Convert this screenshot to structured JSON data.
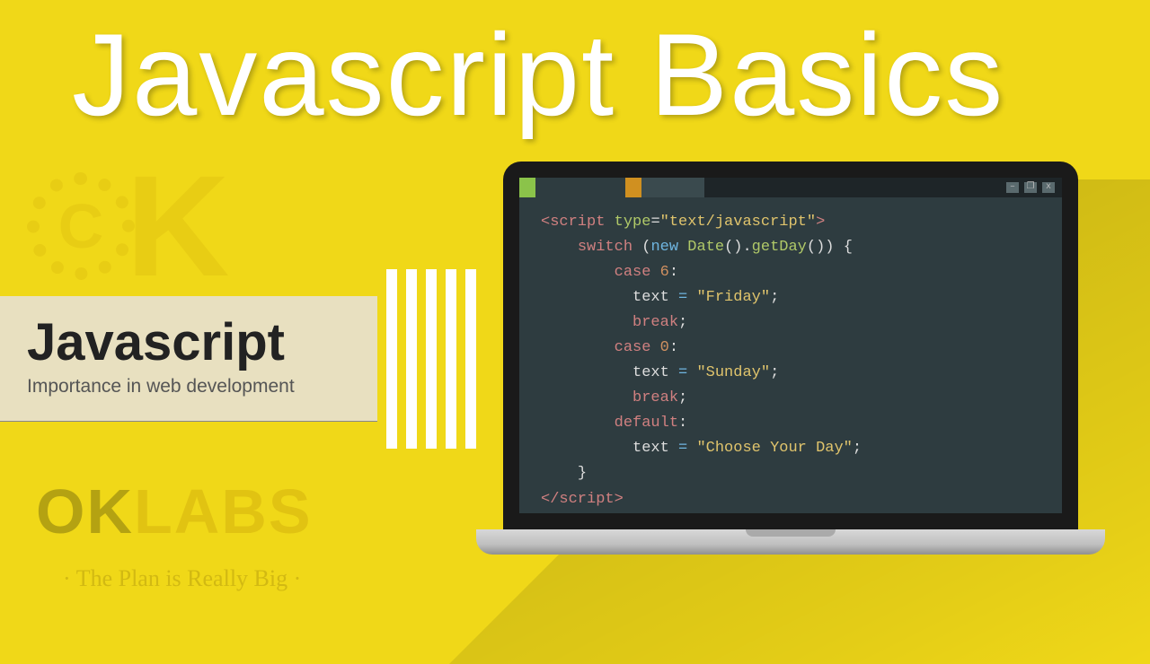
{
  "title": "Javascript Basics",
  "banner": {
    "heading": "Javascript",
    "subtext": "Importance in web development"
  },
  "watermark": {
    "brand_ok": "OK",
    "brand_labs": "LABS",
    "tagline": "· The Plan is Really Big ·"
  },
  "code": {
    "line1_open": "<script",
    "line1_attr": " type",
    "line1_eq": "=",
    "line1_val": "\"text/javascript\"",
    "line1_close": ">",
    "line2_kw": "switch",
    "line2_paren_open": " (",
    "line2_new": "new",
    "line2_date": " Date",
    "line2_call1": "().",
    "line2_getday": "getDay",
    "line2_call2": "()) {",
    "line3_case": "case",
    "line3_num": " 6",
    "line3_colon": ":",
    "line4_var": "text ",
    "line4_eq": "= ",
    "line4_str": "\"Friday\"",
    "line4_semi": ";",
    "line5": "break",
    "line5_semi": ";",
    "line6_case": "case",
    "line6_num": " 0",
    "line6_colon": ":",
    "line7_var": "text ",
    "line7_eq": "= ",
    "line7_str": "\"Sunday\"",
    "line7_semi": ";",
    "line8": "break",
    "line8_semi": ";",
    "line9": "default",
    "line9_colon": ":",
    "line10_var": "text ",
    "line10_eq": "= ",
    "line10_str": "\"Choose Your Day\"",
    "line10_semi": ";",
    "line11": "}",
    "line12": "</scr",
    "line12b": "ipt>"
  },
  "window_controls": {
    "min": "–",
    "max": "❐",
    "close": "x"
  }
}
